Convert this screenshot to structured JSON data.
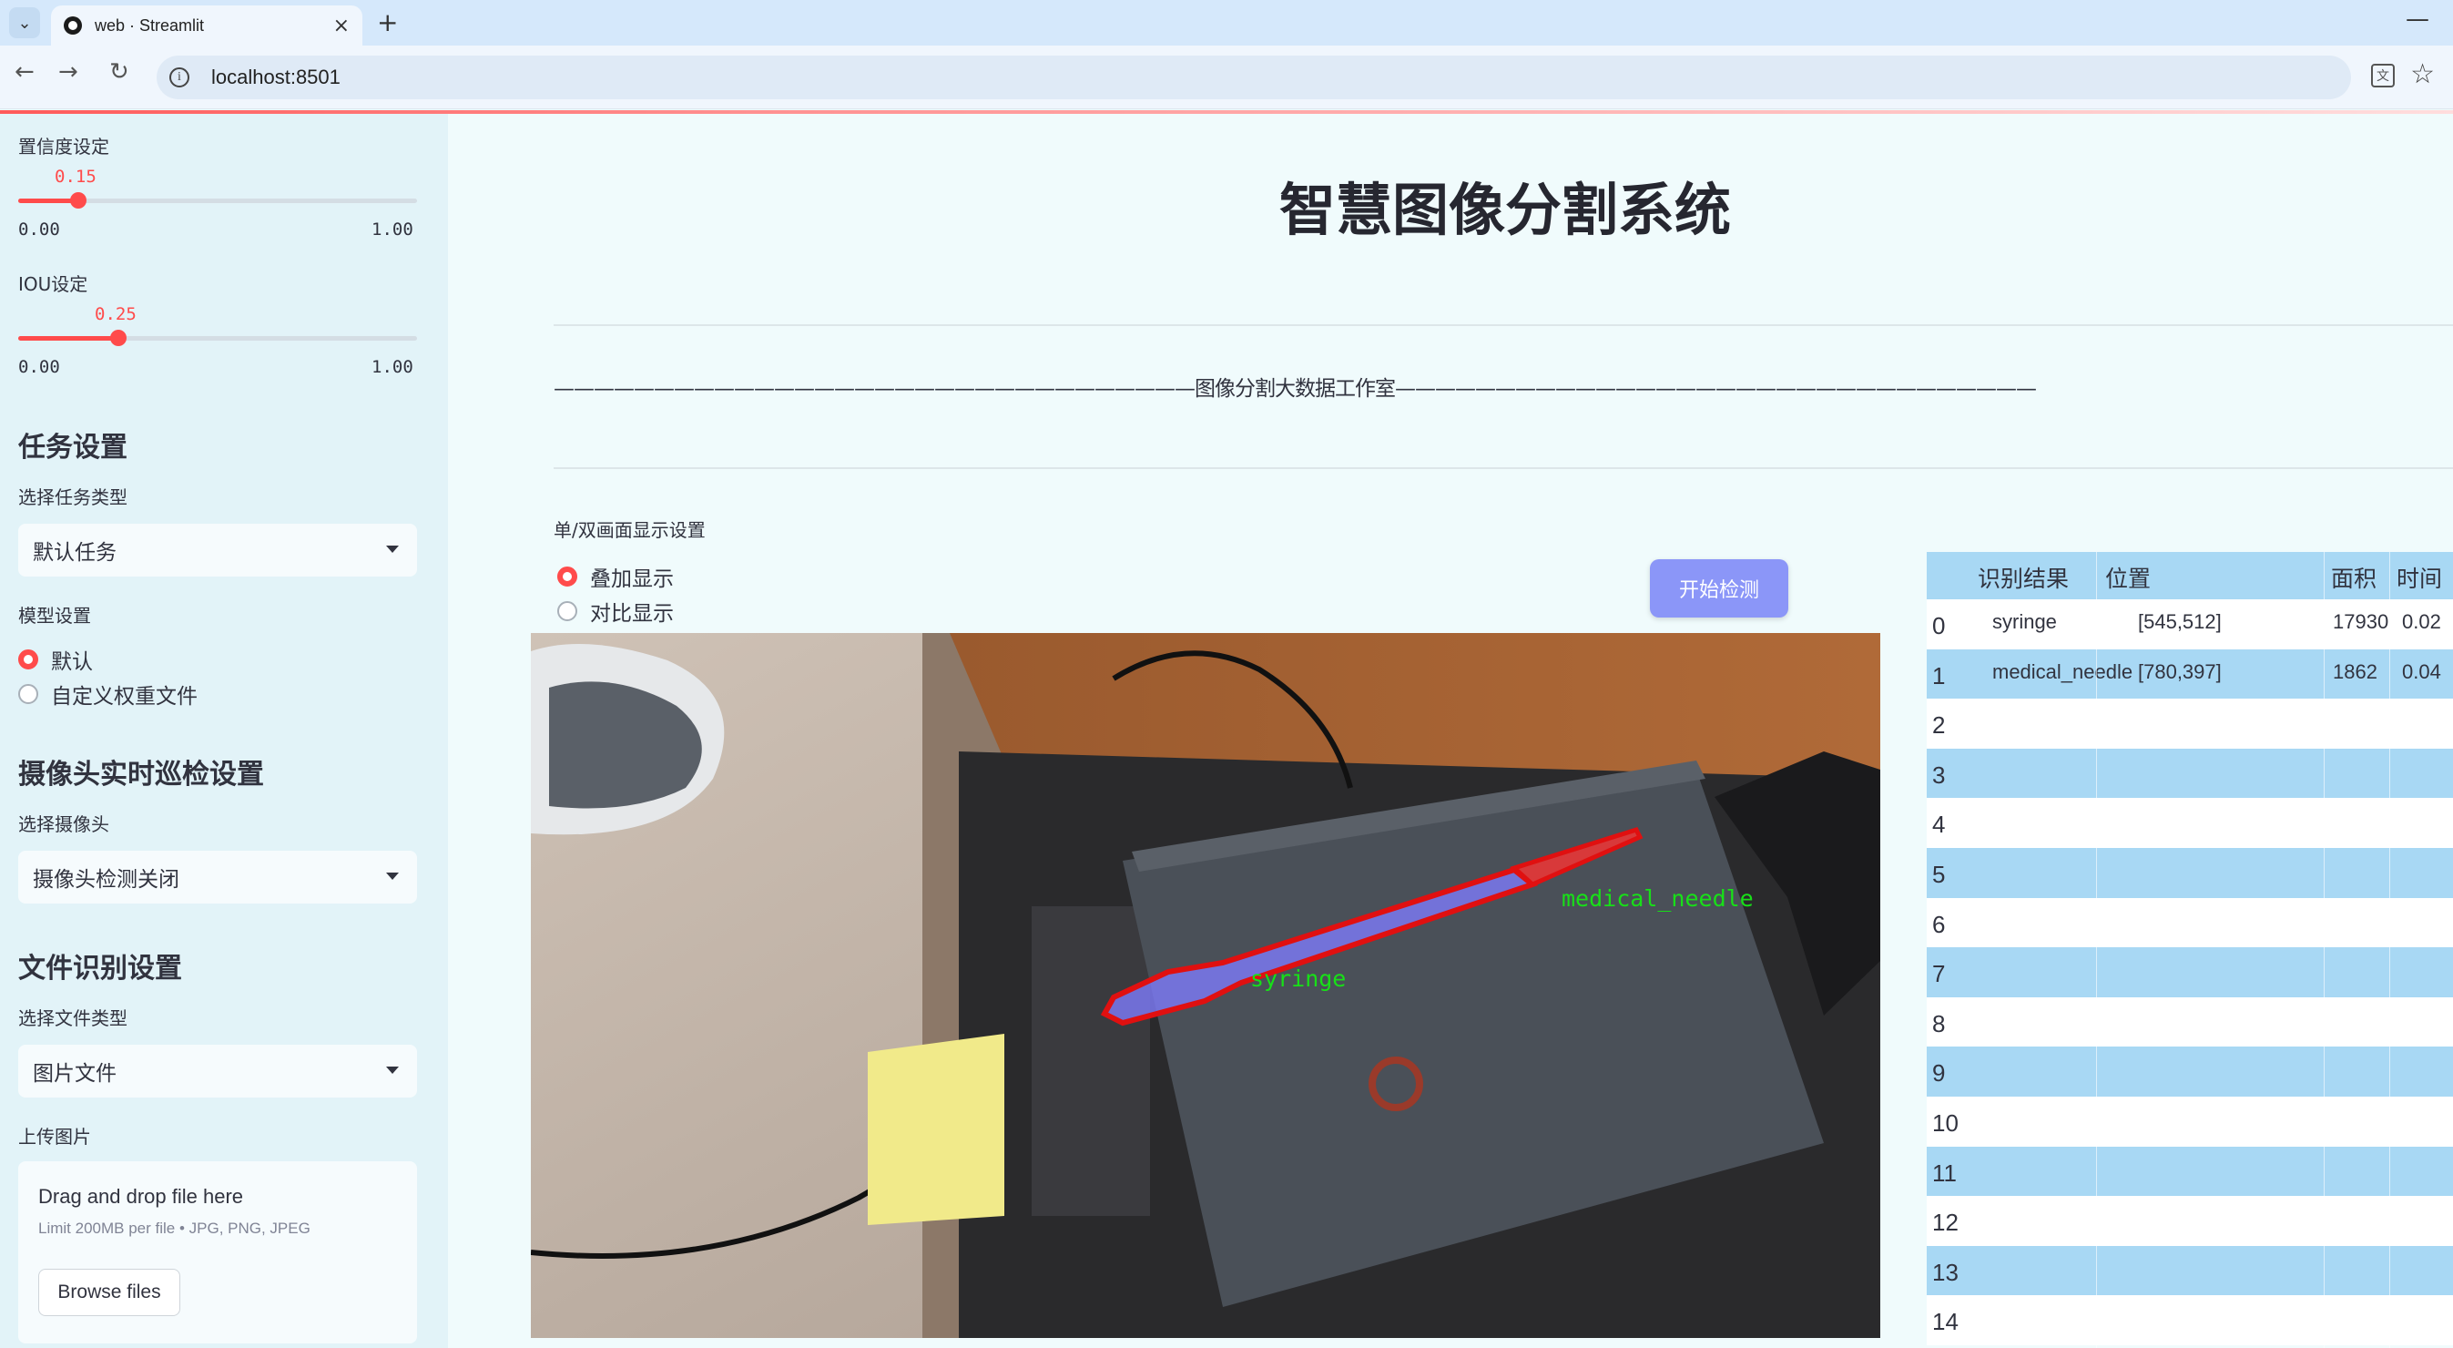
{
  "browser": {
    "tab_title": "web · Streamlit",
    "url": "localhost:8501",
    "translate_icon": "translate-icon",
    "star_icon": "star-icon"
  },
  "sidebar": {
    "confidence": {
      "label": "置信度设定",
      "value": "0.15",
      "fraction": 0.15,
      "min": "0.00",
      "max": "1.00"
    },
    "iou": {
      "label": "IOU设定",
      "value": "0.25",
      "fraction": 0.25,
      "min": "0.00",
      "max": "1.00"
    },
    "task_heading": "任务设置",
    "task_type_label": "选择任务类型",
    "task_type_value": "默认任务",
    "model_label": "模型设置",
    "model_options": [
      "默认",
      "自定义权重文件"
    ],
    "camera_heading": "摄像头实时巡检设置",
    "camera_label": "选择摄像头",
    "camera_value": "摄像头检测关闭",
    "file_heading": "文件识别设置",
    "file_type_label": "选择文件类型",
    "file_type_value": "图片文件",
    "upload_label": "上传图片",
    "upload_drop_text": "Drag and drop file here",
    "upload_limit_text": "Limit 200MB per file • JPG, PNG, JPEG",
    "browse_button": "Browse files"
  },
  "main": {
    "title": "智慧图像分割系统",
    "banner": "————————————————————————————————图像分割大数据工作室————————————————————————————————",
    "display_label": "单/双画面显示设置",
    "display_options": [
      "叠加显示",
      "对比显示"
    ],
    "start_button": "开始检测",
    "detection_labels": {
      "syringe": "syringe",
      "needle": "medical_needle"
    }
  },
  "table": {
    "headers": [
      "识别结果",
      "位置",
      "面积",
      "时间"
    ],
    "rows": [
      {
        "index": "0",
        "result": "syringe",
        "position": "[545,512]",
        "area": "17930",
        "time": "0.02"
      },
      {
        "index": "1",
        "result": "medical_needle",
        "position": "[780,397]",
        "area": "1862",
        "time": "0.04"
      },
      {
        "index": "2"
      },
      {
        "index": "3"
      },
      {
        "index": "4"
      },
      {
        "index": "5"
      },
      {
        "index": "6"
      },
      {
        "index": "7"
      },
      {
        "index": "8"
      },
      {
        "index": "9"
      },
      {
        "index": "10"
      },
      {
        "index": "11"
      },
      {
        "index": "12"
      },
      {
        "index": "13"
      },
      {
        "index": "14"
      }
    ]
  },
  "colors": {
    "accent": "#ff4b4b",
    "button": "#8b96f8",
    "table_stripe": "#a8d8f4",
    "sidebar_bg": "#e2f3f8"
  }
}
